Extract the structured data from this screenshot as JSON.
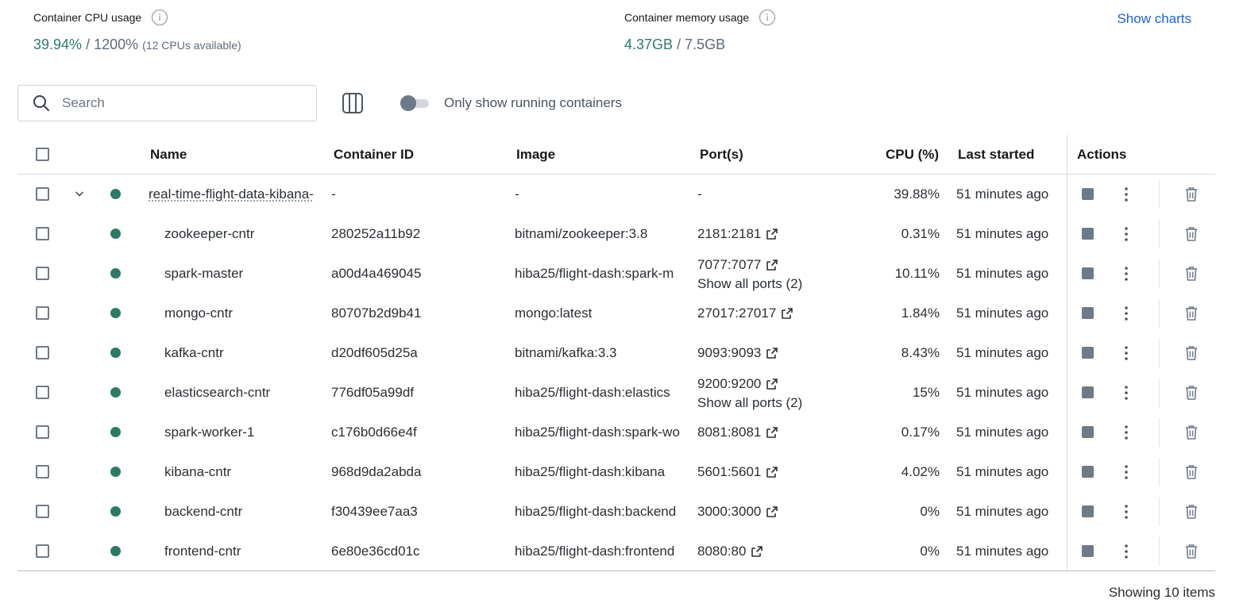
{
  "stats": {
    "cpu": {
      "label": "Container CPU usage",
      "used": "39.94%",
      "total": "1200%",
      "note": "(12 CPUs available)"
    },
    "memory": {
      "label": "Container memory usage",
      "used": "4.37GB",
      "total": "7.5GB"
    },
    "show_charts": "Show charts"
  },
  "toolbar": {
    "search_placeholder": "Search",
    "toggle_label": "Only show running containers"
  },
  "table": {
    "headers": {
      "name": "Name",
      "id": "Container ID",
      "image": "Image",
      "ports": "Port(s)",
      "cpu": "CPU (%)",
      "last": "Last started",
      "actions": "Actions"
    },
    "rows": [
      {
        "name": "real-time-flight-data-kibana-",
        "id": "-",
        "image": "-",
        "port": "-",
        "cpu": "39.88%",
        "last": "51 minutes ago"
      },
      {
        "name": "zookeeper-cntr",
        "id": "280252a11b92",
        "image": "bitnami/zookeeper:3.8",
        "port": "2181:2181",
        "cpu": "0.31%",
        "last": "51 minutes ago"
      },
      {
        "name": "spark-master",
        "id": "a00d4a469045",
        "image": "hiba25/flight-dash:spark-m",
        "port": "7077:7077",
        "extra": "Show all ports (2)",
        "cpu": "10.11%",
        "last": "51 minutes ago"
      },
      {
        "name": "mongo-cntr",
        "id": "80707b2d9b41",
        "image": "mongo:latest",
        "port": "27017:27017",
        "cpu": "1.84%",
        "last": "51 minutes ago"
      },
      {
        "name": "kafka-cntr",
        "id": "d20df605d25a",
        "image": "bitnami/kafka:3.3",
        "port": "9093:9093",
        "cpu": "8.43%",
        "last": "51 minutes ago"
      },
      {
        "name": "elasticsearch-cntr",
        "id": "776df05a99df",
        "image": "hiba25/flight-dash:elastics",
        "port": "9200:9200",
        "extra": "Show all ports (2)",
        "cpu": "15%",
        "last": "51 minutes ago"
      },
      {
        "name": "spark-worker-1",
        "id": "c176b0d66e4f",
        "image": "hiba25/flight-dash:spark-wo",
        "port": "8081:8081",
        "cpu": "0.17%",
        "last": "51 minutes ago"
      },
      {
        "name": "kibana-cntr",
        "id": "968d9da2abda",
        "image": "hiba25/flight-dash:kibana",
        "port": "5601:5601",
        "cpu": "4.02%",
        "last": "51 minutes ago"
      },
      {
        "name": "backend-cntr",
        "id": "f30439ee7aa3",
        "image": "hiba25/flight-dash:backend",
        "port": "3000:3000",
        "cpu": "0%",
        "last": "51 minutes ago"
      },
      {
        "name": "frontend-cntr",
        "id": "6e80e36cd01c",
        "image": "hiba25/flight-dash:frontend",
        "port": "8080:80",
        "cpu": "0%",
        "last": "51 minutes ago"
      }
    ]
  },
  "footer": {
    "showing": "Showing 10 items"
  },
  "colors": {
    "accent_link": "#1d63d6",
    "running_dot": "#2b7a66",
    "stat_highlight": "#2e7d6b"
  },
  "icons": {
    "info": "info-icon",
    "search": "search-icon",
    "columns": "columns-icon",
    "expand": "chevron-down-icon",
    "external": "external-link-icon",
    "stop": "stop-icon",
    "more": "kebab-icon",
    "delete": "trash-icon"
  }
}
